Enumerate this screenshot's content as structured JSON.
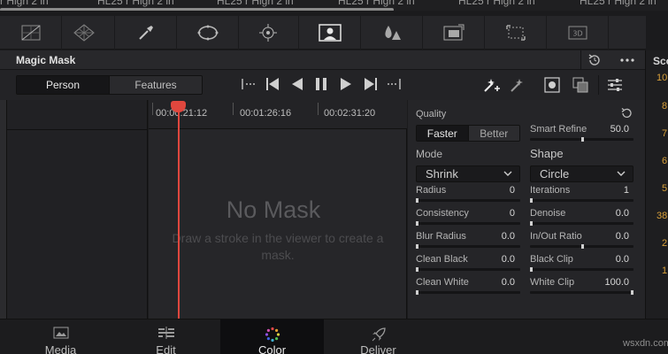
{
  "clip_strip": {
    "labels": [
      "r High 2 in",
      "HL25 r High 2 in",
      "HL25 r High 2 in",
      "HL25 r High 2 in",
      "HL25 r High 2 in",
      "HL25 r High 2 in"
    ]
  },
  "panel": {
    "title": "Magic Mask",
    "segments": [
      "Person",
      "Features"
    ],
    "active_segment": "Person"
  },
  "scopes": {
    "title": "Sco",
    "numbers": [
      "10",
      "8",
      "7",
      "6",
      "5",
      "38",
      "2",
      "1"
    ]
  },
  "timeline": {
    "timecodes": [
      "00:00:21:12",
      "00:01:26:16",
      "00:02:31:20"
    ],
    "empty_title": "No Mask",
    "empty_hint": "Draw a stroke in the viewer to create a mask."
  },
  "params": {
    "quality": {
      "label": "Quality",
      "options": [
        "Faster",
        "Better"
      ],
      "selected": "Faster"
    },
    "smart_refine": {
      "label": "Smart Refine",
      "value": "50.0",
      "level": 0.5
    },
    "mode": {
      "label": "Mode",
      "value": "Shrink"
    },
    "shape": {
      "label": "Shape",
      "value": "Circle"
    },
    "left": [
      {
        "label": "Radius",
        "value": "0",
        "level": 0.0
      },
      {
        "label": "Consistency",
        "value": "0",
        "level": 0.0
      },
      {
        "label": "Blur Radius",
        "value": "0.0",
        "level": 0.0
      },
      {
        "label": "Clean Black",
        "value": "0.0",
        "level": 0.0
      },
      {
        "label": "Clean White",
        "value": "0.0",
        "level": 0.0
      }
    ],
    "right": [
      {
        "label": "Iterations",
        "value": "1",
        "level": 0.0
      },
      {
        "label": "Denoise",
        "value": "0.0",
        "level": 0.0
      },
      {
        "label": "In/Out Ratio",
        "value": "0.0",
        "level": 0.5
      },
      {
        "label": "Black Clip",
        "value": "0.0",
        "level": 0.0
      },
      {
        "label": "White Clip",
        "value": "100.0",
        "level": 1.0
      }
    ]
  },
  "nav": {
    "tabs": [
      "Media",
      "Edit",
      "Color",
      "Deliver"
    ],
    "active": "Color"
  },
  "watermark": "wsxdn.com"
}
